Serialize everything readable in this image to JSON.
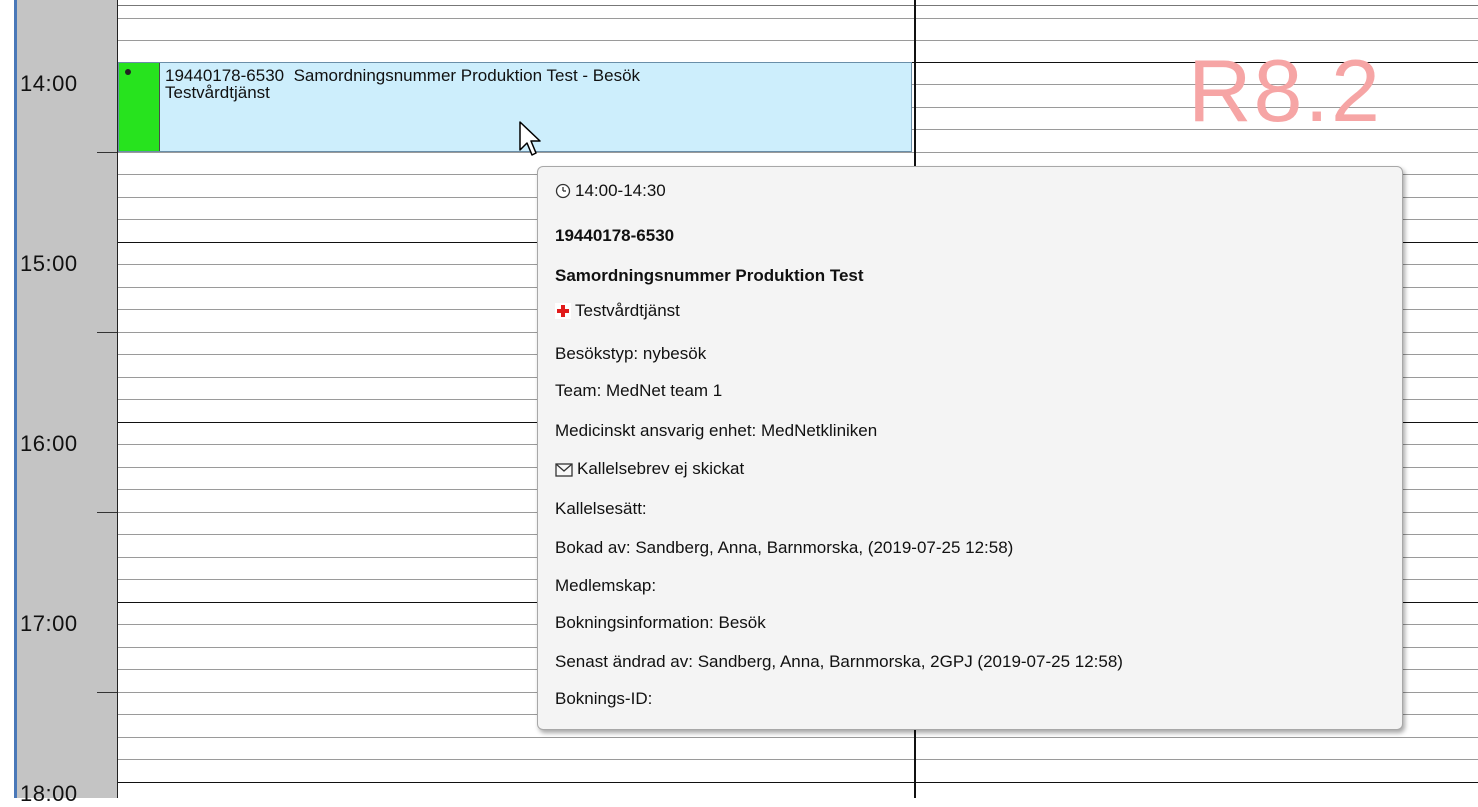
{
  "timeline": {
    "hours": [
      "14:00",
      "15:00",
      "16:00",
      "17:00",
      "18:00"
    ]
  },
  "watermark": "R8.2",
  "event": {
    "title_line1": "19440178-6530  Samordningsnummer Produktion Test - Besök",
    "title_line2": "Testvårdtjänst",
    "status_color": "#27e31e",
    "background_color": "#cdeefc"
  },
  "tooltip": {
    "time": "14:00-14:30",
    "personal_number": "19440178-6530",
    "patient_name": "Samordningsnummer Produktion Test",
    "care_service": "Testvårdtjänst",
    "visit_type": "Besökstyp: nybesök",
    "team": "Team: MedNet team 1",
    "responsible_unit": "Medicinskt ansvarig enhet: MedNetkliniken",
    "letter_status": "Kallelsebrev ej skickat",
    "summons_method": "Kallelsesätt:",
    "booked_by": "Bokad av: Sandberg, Anna, Barnmorska, (2019-07-25 12:58)",
    "membership": "Medlemskap:",
    "booking_info": "Bokningsinformation: Besök",
    "last_changed_by": "Senast ändrad av: Sandberg, Anna, Barnmorska, 2GPJ (2019-07-25 12:58)",
    "booking_id": "Boknings-ID:"
  },
  "icons": {
    "clock": "clock-icon",
    "care": "red-cross-icon",
    "letter": "envelope-icon",
    "cursor": "mouse-pointer-icon"
  }
}
